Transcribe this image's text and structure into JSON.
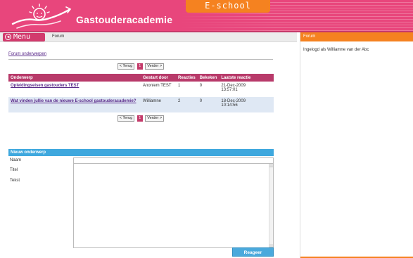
{
  "header": {
    "brand": "Gastouderacademie",
    "eschool_tab": "E-school"
  },
  "menubar": {
    "menu_label": "Menu",
    "menu_icon_glyph": "◀",
    "crumb": "Forum"
  },
  "main": {
    "topics_link": "Forum onderwerpen",
    "pager": {
      "prev": "< Terug",
      "current": "1",
      "next": "Verder >"
    },
    "table": {
      "headers": [
        "Onderwerp",
        "Gestart door",
        "Reacties",
        "Bekeken",
        "Laatste reactie"
      ],
      "rows": [
        {
          "subject": "Opleidingseisen gastouders TEST",
          "started_by": "Anoniem TEST",
          "replies": "1",
          "views": "0",
          "last_date": "21-Dec-2009",
          "last_time": "13:57:01"
        },
        {
          "subject": "Wat vinden jullie van de nieuwe E-school gastouderacademie?",
          "started_by": "Williamne",
          "replies": "2",
          "views": "0",
          "last_date": "18-Dec-2009",
          "last_time": "10:14:56"
        }
      ]
    },
    "new_topic": {
      "heading": "Nieuw onderwerp",
      "name_label": "Naam",
      "title_label": "Titel",
      "text_label": "Tekst",
      "submit": "Reageer"
    }
  },
  "side": {
    "heading": "Forum",
    "logged_in": "Ingelogd als Williamne van der Abc"
  },
  "colors": {
    "header_pink": "#e8467c",
    "eschool_orange": "#f58220",
    "table_header": "#b83a6a",
    "form_header_blue": "#3fa8de",
    "link_purple": "#5a2a8a"
  }
}
